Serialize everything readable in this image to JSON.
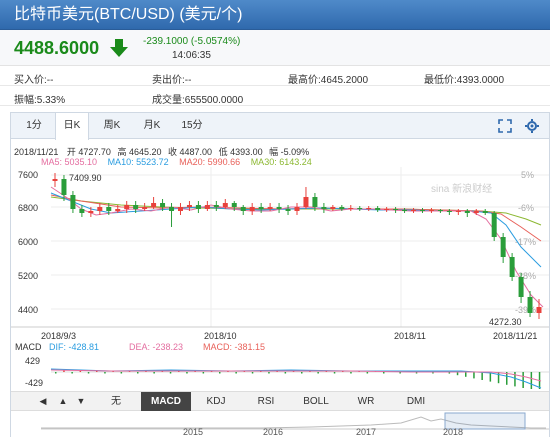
{
  "title": "比特币美元(BTC/USD) (美元/个)",
  "price": {
    "last": "4488.6000",
    "change": "-239.1000 (-5.0574%)",
    "time": "14:06:35",
    "down_color": "#1a8a1a",
    "arrow_icon": "down-arrow-icon"
  },
  "stats": {
    "buy": "买入价:--",
    "sell": "卖出价:--",
    "high": "最高价:4645.2000",
    "low": "最低价:4393.0000",
    "amplitude": "振幅:5.33%",
    "volume": "成交量:655500.0000"
  },
  "tabs": [
    "1分",
    "日K",
    "周K",
    "月K",
    "15分"
  ],
  "active_tab": "日K",
  "toolbar_icons": [
    "fullscreen-icon",
    "settings-icon"
  ],
  "ohlc": {
    "date": "2018/11/21",
    "open": "开 4727.70",
    "high": "高 4645.20",
    "close": "收 4487.00",
    "low": "低 4393.00",
    "amp": "幅 -5.09%"
  },
  "ma": {
    "ma5": "MA5: 5035.10",
    "ma10": "MA10: 5523.72",
    "ma20": "MA20: 5990.66",
    "ma30": "MA30: 6143.24",
    "colors": {
      "ma5": "#e46ea0",
      "ma10": "#2b9de0",
      "ma20": "#e8615a",
      "ma30": "#8cb832"
    }
  },
  "watermark": "sina 新浪财经",
  "chart": {
    "y_ticks": [
      "7600",
      "6800",
      "6000",
      "5200",
      "4400"
    ],
    "pct_ticks": [
      "5%",
      "-6%",
      "-17%",
      "-28%",
      "-39%"
    ],
    "x_ticks": [
      "2018/9/3",
      "2018/10",
      "2018/11",
      "2018/11/21"
    ],
    "max_label": "7409.90",
    "min_label": "4272.30",
    "up_color": "#e8413c",
    "down_color": "#2a9d3a"
  },
  "macd": {
    "label": "MACD",
    "dif": "DIF: -428.81",
    "dea": "DEA: -238.23",
    "macd": "MACD: -381.15",
    "top": "429",
    "bottom": "-429"
  },
  "indicator_tabs": [
    "无",
    "MACD",
    "KDJ",
    "RSI",
    "BOLL",
    "WR",
    "DMI"
  ],
  "active_indicator": "MACD",
  "nav": [
    "◀",
    "▲",
    "▼"
  ],
  "timeline_years": [
    "2015",
    "2016",
    "2017",
    "2018"
  ],
  "chart_data": {
    "type": "candlestick",
    "x_range": [
      "2018/9/3",
      "2018/11/21"
    ],
    "ylim": [
      4272.3,
      7409.9
    ],
    "y_ticks": [
      7600,
      6800,
      6000,
      5200,
      4400
    ],
    "annotations": [
      {
        "label": "7409.90",
        "type": "max"
      },
      {
        "label": "4272.30",
        "type": "min"
      }
    ],
    "last_candle": {
      "date": "2018/11/21",
      "open": 4727.7,
      "high": 4645.2,
      "close": 4487.0,
      "low": 4393.0
    },
    "ma": {
      "MA5": 5035.1,
      "MA10": 5523.72,
      "MA20": 5990.66,
      "MA30": 6143.24
    },
    "macd": {
      "DIF": -428.81,
      "DEA": -238.23,
      "MACD": -381.15,
      "ylim": [
        -429,
        429
      ]
    }
  }
}
